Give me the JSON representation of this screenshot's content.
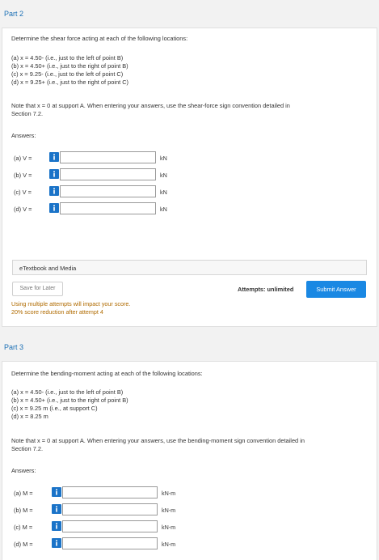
{
  "part2": {
    "title": "Part 2",
    "question": "Determine the shear force acting at each of the following locations:",
    "items": [
      "(a) x = 4.50- (i.e., just to the left of point B)",
      "(b) x = 4.50+ (i.e., just to the right of point B)",
      "(c) x = 9.25- (i.e., just to the left of point C)",
      "(d) x = 9.25+ (i.e., just to the right of point C)"
    ],
    "note_line1": "Note that x = 0 at support A. When entering your answers, use the shear-force sign convention detailed in",
    "note_line2": "Section 7.2.",
    "answers_label": "Answers:",
    "answers": [
      {
        "label": "(a)   V =",
        "value": "",
        "unit": "kN"
      },
      {
        "label": "(b)   V =",
        "value": "",
        "unit": "kN"
      },
      {
        "label": "(c)   V =",
        "value": "",
        "unit": "kN"
      },
      {
        "label": "(d)   V =",
        "value": "",
        "unit": "kN"
      }
    ],
    "etextbook": "eTextbook and Media",
    "save_label": "Save for Later",
    "attempts": "Attempts: unlimited",
    "submit_label": "Submit Answer",
    "warning_line1": "Using multiple attempts will impact your score.",
    "warning_line2": "20% score reduction after attempt 4"
  },
  "part3": {
    "title": "Part 3",
    "question": "Determine the bending-moment acting at each of the following locations:",
    "items": [
      "(a) x = 4.50- (i.e., just to the left of point B)",
      "(b) x = 4.50+ (i.e., just to the right of point B)",
      "(c) x = 9.25 m (i.e., at support C)",
      "(d) x = 8.25 m"
    ],
    "note_line1": "Note that x = 0 at support A. When entering your answers, use the bending-moment sign convention detailed in",
    "note_line2": "Section 7.2.",
    "answers_label": "Answers:",
    "answers": [
      {
        "label": "(a)   M =",
        "value": "",
        "unit": "kN-m"
      },
      {
        "label": "(b)   M =",
        "value": "",
        "unit": "kN-m"
      },
      {
        "label": "(c)   M =",
        "value": "",
        "unit": "kN-m"
      },
      {
        "label": "(d)   M =",
        "value": "",
        "unit": "kN-m"
      }
    ]
  },
  "colors": {
    "accent": "#1a88e3",
    "info_button": "#1a73c8",
    "part_title": "#1a6fb5",
    "warning": "#b06b00"
  },
  "icons": {
    "info": "info-icon"
  }
}
